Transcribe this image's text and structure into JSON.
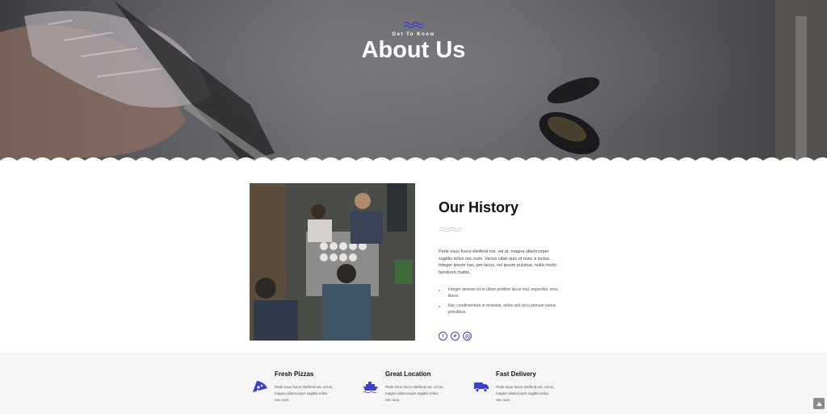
{
  "hero": {
    "kicker": "Get To Know",
    "title": "About Us"
  },
  "history": {
    "title": "Our History",
    "body": "Pede risus fusce eleifend est, vel at, magna ullamcorper sagittis tellus nec num. Varius vitae quis ut nunc a luctus. Integer ipsum hac, per lacus, vel ipsum pulvinar, nulla morbi hendrerit mattis.",
    "list": [
      "Integer aenean sit et ullam porttitor lacus mul, imperdiet, eros, libero.",
      "Nec condimentum in molestie, tellus sed arcu primum varius primitibus."
    ],
    "socials": [
      "facebook-icon",
      "twitter-icon",
      "dribbble-icon"
    ]
  },
  "features": [
    {
      "title": "Fresh Pizzas",
      "text": "Pede risus fusce eleifend est, vel at, magna ullamcorper sagittis tellus nec num.",
      "icon": "pizza-slice-icon"
    },
    {
      "title": "Great Location",
      "text": "Pede risus fusce eleifend est, vel at, magna ullamcorper sagittis tellus nec num.",
      "icon": "ship-icon"
    },
    {
      "title": "Fast Delivery",
      "text": "Pede risus fusce eleifend est, vel at, magna ullamcorper sagittis tellus nec num.",
      "icon": "truck-icon"
    }
  ],
  "colors": {
    "accent": "#3b3fd0",
    "hero_bg": "#5e5e62",
    "features_bg": "#f5f5f5"
  }
}
